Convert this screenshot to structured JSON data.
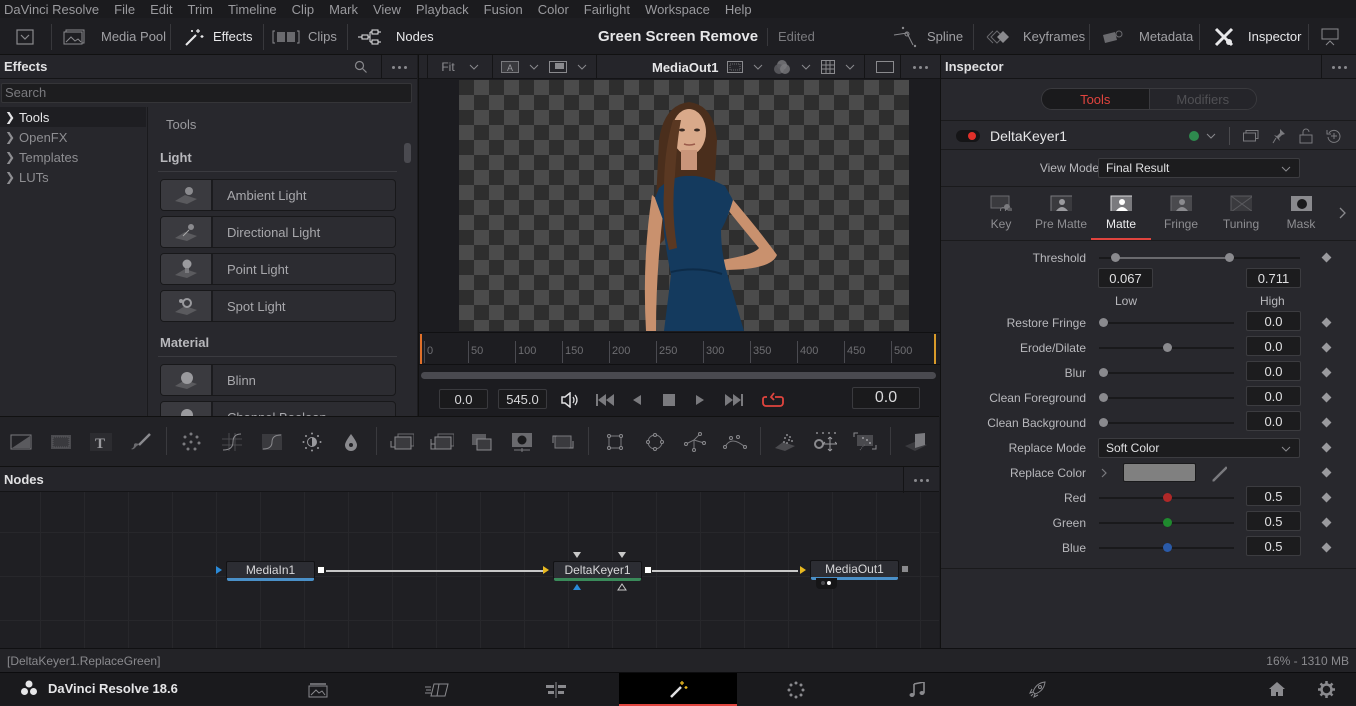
{
  "menu": [
    "DaVinci Resolve",
    "File",
    "Edit",
    "Trim",
    "Timeline",
    "Clip",
    "Mark",
    "View",
    "Playback",
    "Fusion",
    "Color",
    "Fairlight",
    "Workspace",
    "Help"
  ],
  "toolbar": {
    "left": [
      {
        "label": "Media Pool",
        "icon": "media-pool-icon",
        "active": false
      },
      {
        "label": "Effects",
        "icon": "effects-wand-icon",
        "active": true
      },
      {
        "label": "Clips",
        "icon": "clips-icon",
        "active": false
      },
      {
        "label": "Nodes",
        "icon": "nodes-icon",
        "active": true
      }
    ],
    "project_title": "Green Screen Remove",
    "project_status": "Edited",
    "right": [
      {
        "label": "Spline",
        "icon": "spline-icon",
        "active": false
      },
      {
        "label": "Keyframes",
        "icon": "keyframes-icon",
        "active": false
      },
      {
        "label": "Metadata",
        "icon": "metadata-icon",
        "active": false
      },
      {
        "label": "Inspector",
        "icon": "inspector-icon",
        "active": true
      }
    ]
  },
  "effects": {
    "title": "Effects",
    "search_placeholder": "Search",
    "tree": [
      {
        "label": "Tools",
        "selected": true
      },
      {
        "label": "OpenFX",
        "selected": false
      },
      {
        "label": "Templates",
        "selected": false
      },
      {
        "label": "LUTs",
        "selected": false
      }
    ],
    "list_header": "Tools",
    "sections": [
      {
        "title": "Light",
        "items": [
          "Ambient Light",
          "Directional Light",
          "Point Light",
          "Spot Light"
        ]
      },
      {
        "title": "Material",
        "items": [
          "Blinn",
          "Channel Boolean"
        ]
      }
    ]
  },
  "viewer": {
    "zoom": "Fit",
    "node_name": "MediaOut1",
    "ruler_ticks": [
      "0",
      "50",
      "100",
      "150",
      "200",
      "250",
      "300",
      "350",
      "400",
      "450",
      "500"
    ],
    "start_time": "0.0",
    "end_time": "545.0",
    "current_time": "0.0",
    "loop_color": "#e0443e"
  },
  "nodes_panel": {
    "title": "Nodes",
    "nodes": [
      {
        "name": "MediaIn1",
        "bar_color": "#4a90c8"
      },
      {
        "name": "DeltaKeyer1",
        "bar_color": "#3a8a5a"
      },
      {
        "name": "MediaOut1",
        "bar_color": "#4a90c8"
      }
    ]
  },
  "inspector": {
    "title": "Inspector",
    "tabs": {
      "tools": "Tools",
      "modifiers": "Modifiers"
    },
    "tool_name": "DeltaKeyer1",
    "view_mode_label": "View Mode",
    "view_mode": "Final Result",
    "sub_tabs": [
      {
        "label": "Key",
        "active": false
      },
      {
        "label": "Pre Matte",
        "active": false
      },
      {
        "label": "Matte",
        "active": true
      },
      {
        "label": "Fringe",
        "active": false
      },
      {
        "label": "Tuning",
        "active": false
      },
      {
        "label": "Mask",
        "active": false
      }
    ],
    "threshold": {
      "label": "Threshold",
      "low": "0.067",
      "high": "0.711",
      "low_label": "Low",
      "high_label": "High",
      "low_frac": 0.067,
      "high_frac": 0.711
    },
    "sliders": [
      {
        "label": "Restore Fringe",
        "value": "0.0",
        "frac": 0.0,
        "color": "#8a8a8e"
      },
      {
        "label": "Erode/Dilate",
        "value": "0.0",
        "frac": 0.5,
        "color": "#8a8a8e"
      },
      {
        "label": "Blur",
        "value": "0.0",
        "frac": 0.0,
        "color": "#8a8a8e"
      },
      {
        "label": "Clean Foreground",
        "value": "0.0",
        "frac": 0.0,
        "color": "#8a8a8e"
      },
      {
        "label": "Clean Background",
        "value": "0.0",
        "frac": 0.0,
        "color": "#8a8a8e"
      }
    ],
    "replace_mode_label": "Replace Mode",
    "replace_mode": "Soft Color",
    "replace_color_label": "Replace Color",
    "replace_color": "#808080",
    "rgb": [
      {
        "label": "Red",
        "value": "0.5",
        "frac": 0.5,
        "color": "#b02828"
      },
      {
        "label": "Green",
        "value": "0.5",
        "frac": 0.5,
        "color": "#1f8a2e"
      },
      {
        "label": "Blue",
        "value": "0.5",
        "frac": 0.5,
        "color": "#2a5aa8"
      }
    ]
  },
  "status": {
    "left": "[DeltaKeyer1.ReplaceGreen]",
    "right": "16% - 1310 MB"
  },
  "pagebar": {
    "app_name": "DaVinci Resolve 18.6",
    "pages": [
      {
        "name": "media",
        "icon": "media-page-icon",
        "active": false
      },
      {
        "name": "cut",
        "icon": "cut-page-icon",
        "active": false
      },
      {
        "name": "edit",
        "icon": "edit-page-icon",
        "active": false
      },
      {
        "name": "fusion",
        "icon": "fusion-page-icon",
        "active": true
      },
      {
        "name": "color",
        "icon": "color-page-icon",
        "active": false
      },
      {
        "name": "fairlight",
        "icon": "fairlight-page-icon",
        "active": false
      },
      {
        "name": "deliver",
        "icon": "deliver-page-icon",
        "active": false
      }
    ],
    "accent": "#e0443e"
  }
}
